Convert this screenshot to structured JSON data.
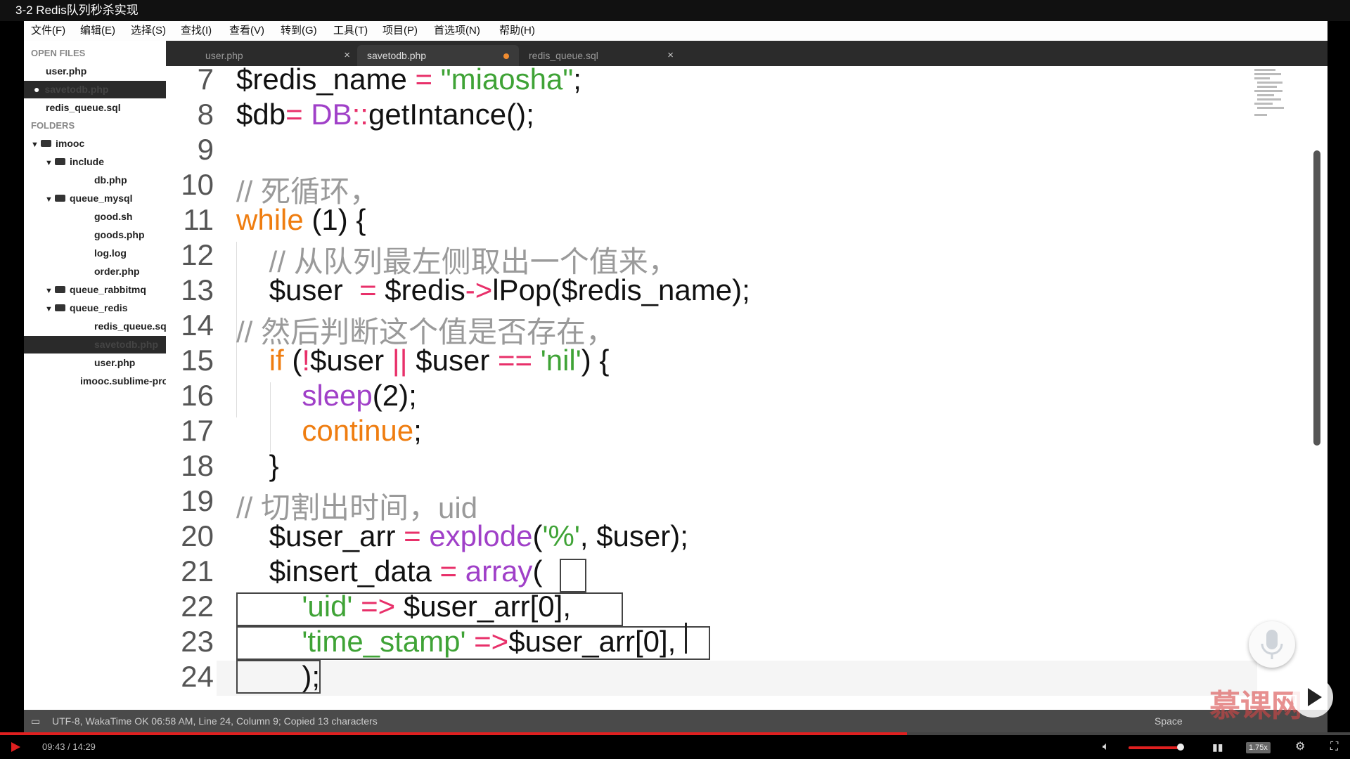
{
  "video": {
    "title": "3-2 Redis队列秒杀实现",
    "time": "09:43 / 14:29",
    "progress_fraction": 0.672,
    "volume_fraction": 0.9,
    "speed": "1.75x",
    "watermark": "慕课网"
  },
  "menu": [
    "文件(F)",
    "编辑(E)",
    "选择(S)",
    "查找(I)",
    "查看(V)",
    "转到(G)",
    "工具(T)",
    "项目(P)",
    "首选项(N)",
    "帮助(H)"
  ],
  "sidebar": {
    "open_files_header": "OPEN FILES",
    "open_files": [
      "user.php",
      "savetodb.php",
      "redis_queue.sql"
    ],
    "folders_header": "FOLDERS",
    "tree": {
      "root": "imooc",
      "include": "include",
      "db": "db.php",
      "queue_mysql": "queue_mysql",
      "good_sh": "good.sh",
      "goods": "goods.php",
      "log": "log.log",
      "order": "order.php",
      "queue_rabbitmq": "queue_rabbitmq",
      "queue_redis": "queue_redis",
      "redis_sql": "redis_queue.sql",
      "savetodb": "savetodb.php",
      "user": "user.php",
      "project": "imooc.sublime-project"
    }
  },
  "tabs": [
    {
      "label": "user.php"
    },
    {
      "label": "savetodb.php"
    },
    {
      "label": "redis_queue.sql"
    }
  ],
  "code": {
    "line_numbers": [
      "7",
      "8",
      "9",
      "10",
      "11",
      "12",
      "13",
      "14",
      "15",
      "16",
      "17",
      "18",
      "19",
      "20",
      "21",
      "22",
      "23",
      "24"
    ]
  },
  "status": {
    "left": "UTF-8, WakaTime OK 06:58 AM, Line 24, Column 9; Copied 13 characters",
    "right": "Space"
  },
  "colors": {
    "keyword": "#ef7d10",
    "string": "#3fa336",
    "operator": "#e8306a",
    "function": "#a040c8",
    "comment": "#9a9a9a",
    "progress": "#e02020"
  }
}
